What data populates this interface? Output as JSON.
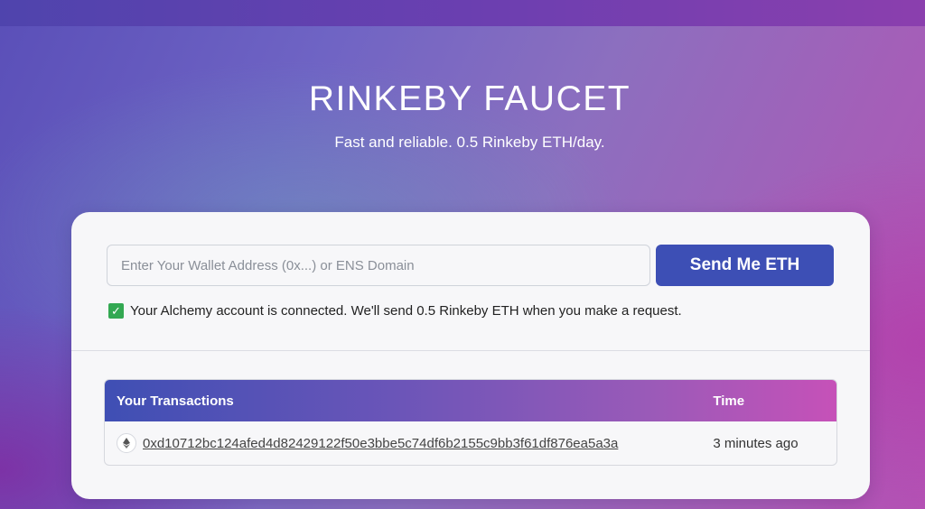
{
  "hero": {
    "title": "RINKEBY FAUCET",
    "subtitle": "Fast and reliable. 0.5 Rinkeby ETH/day."
  },
  "form": {
    "address_placeholder": "Enter Your Wallet Address (0x...) or ENS Domain",
    "address_value": "",
    "send_label": "Send Me ETH"
  },
  "status": {
    "icon": "check-mark-icon",
    "text": "Your Alchemy account is connected. We'll send 0.5 Rinkeby ETH when you make a request."
  },
  "transactions": {
    "headers": {
      "tx": "Your Transactions",
      "time": "Time"
    },
    "rows": [
      {
        "icon": "ethereum-icon",
        "hash": "0xd10712bc124afed4d82429122f50e3bbe5c74df6b2155c9bb3f61df876ea5a3a",
        "time": "3 minutes ago"
      }
    ]
  },
  "colors": {
    "button": "#3d4fb5",
    "check": "#33a852",
    "header_gradient_start": "#3f4fb4",
    "header_gradient_end": "#c651b8"
  }
}
